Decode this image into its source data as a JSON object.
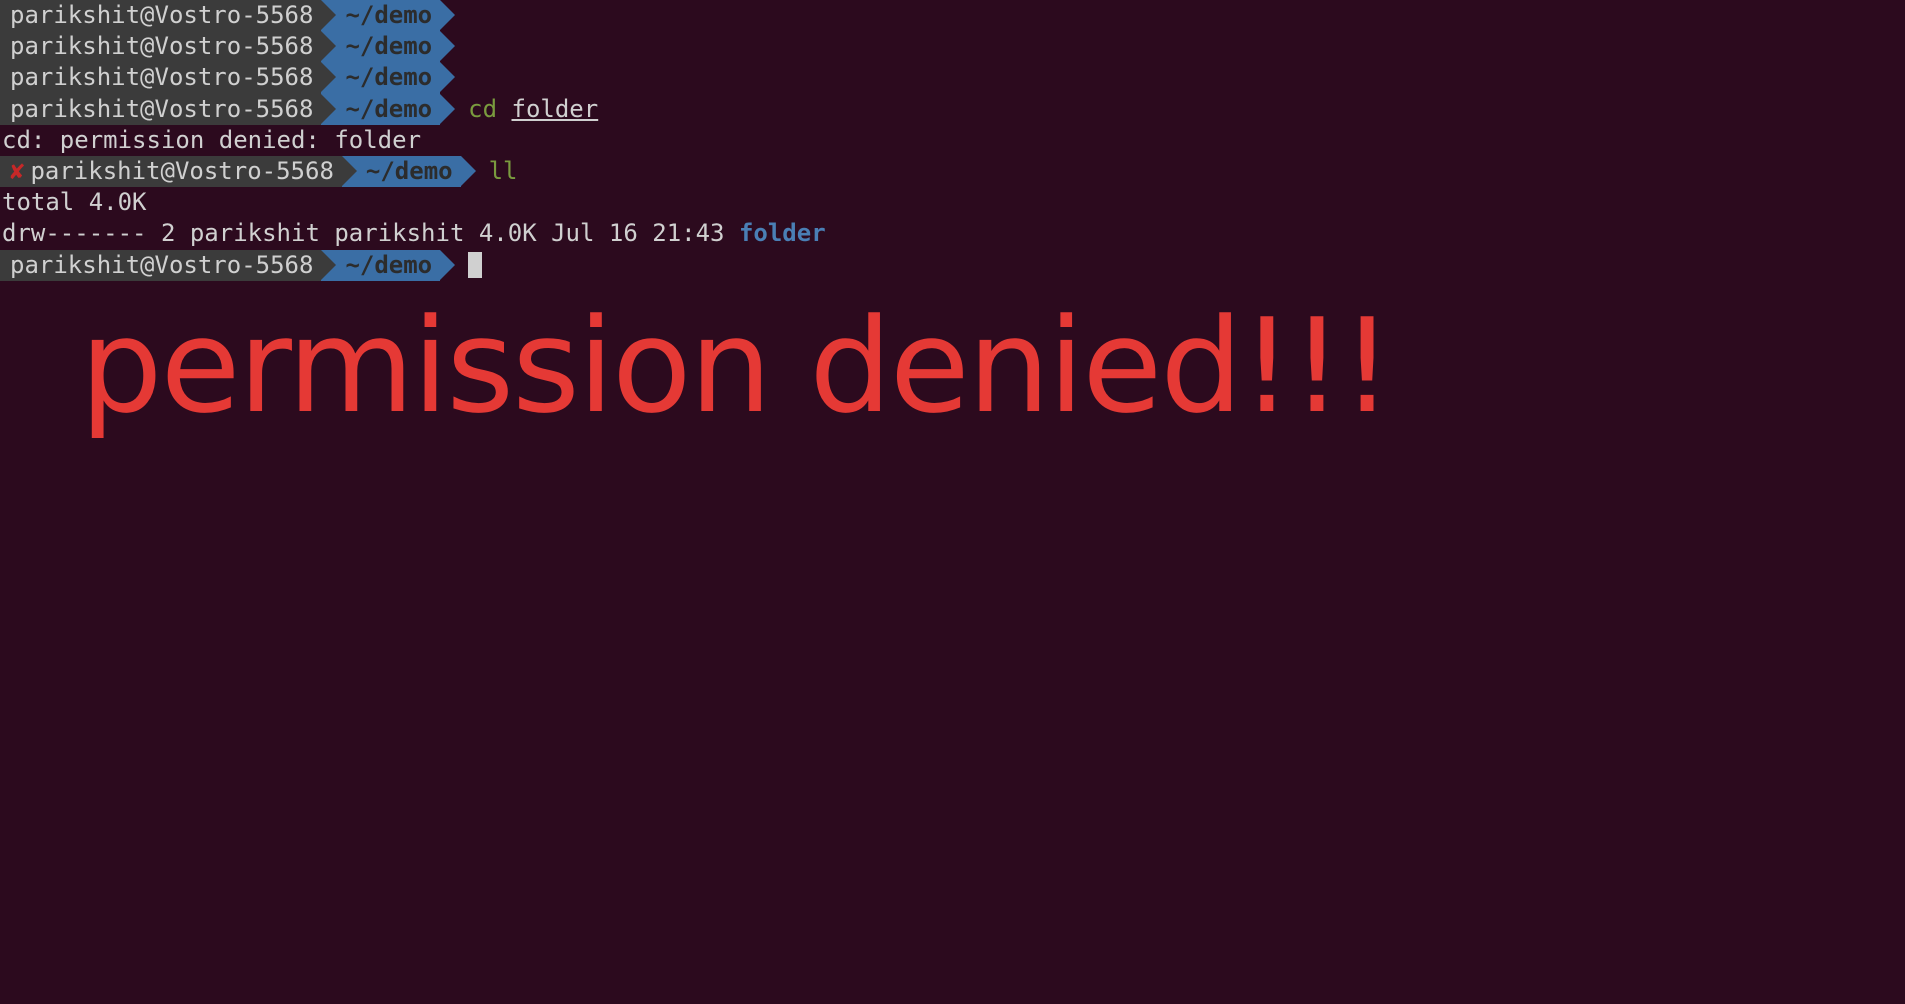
{
  "prompts": [
    {
      "error": false,
      "user_host": "parikshit@Vostro-5568",
      "path": "~/demo",
      "cmd": null,
      "arg": null
    },
    {
      "error": false,
      "user_host": "parikshit@Vostro-5568",
      "path": "~/demo",
      "cmd": null,
      "arg": null
    },
    {
      "error": false,
      "user_host": "parikshit@Vostro-5568",
      "path": "~/demo",
      "cmd": null,
      "arg": null
    },
    {
      "error": false,
      "user_host": "parikshit@Vostro-5568",
      "path": "~/demo",
      "cmd": "cd",
      "arg": "folder",
      "arg_underline": true
    }
  ],
  "error_output": "cd: permission denied: folder",
  "error_mark": "✘",
  "prompt_after_error": {
    "error": true,
    "user_host": "parikshit@Vostro-5568",
    "path": "~/demo",
    "cmd": "ll",
    "arg": null
  },
  "ll_output": {
    "total": "total 4.0K",
    "perms": "drw-------",
    "links": "2",
    "owner": "parikshit",
    "group": "parikshit",
    "size": "4.0K",
    "date": "Jul 16 21:43",
    "name": "folder"
  },
  "final_prompt": {
    "error": false,
    "user_host": "parikshit@Vostro-5568",
    "path": "~/demo"
  },
  "annotation_text": "permission denied!!!"
}
